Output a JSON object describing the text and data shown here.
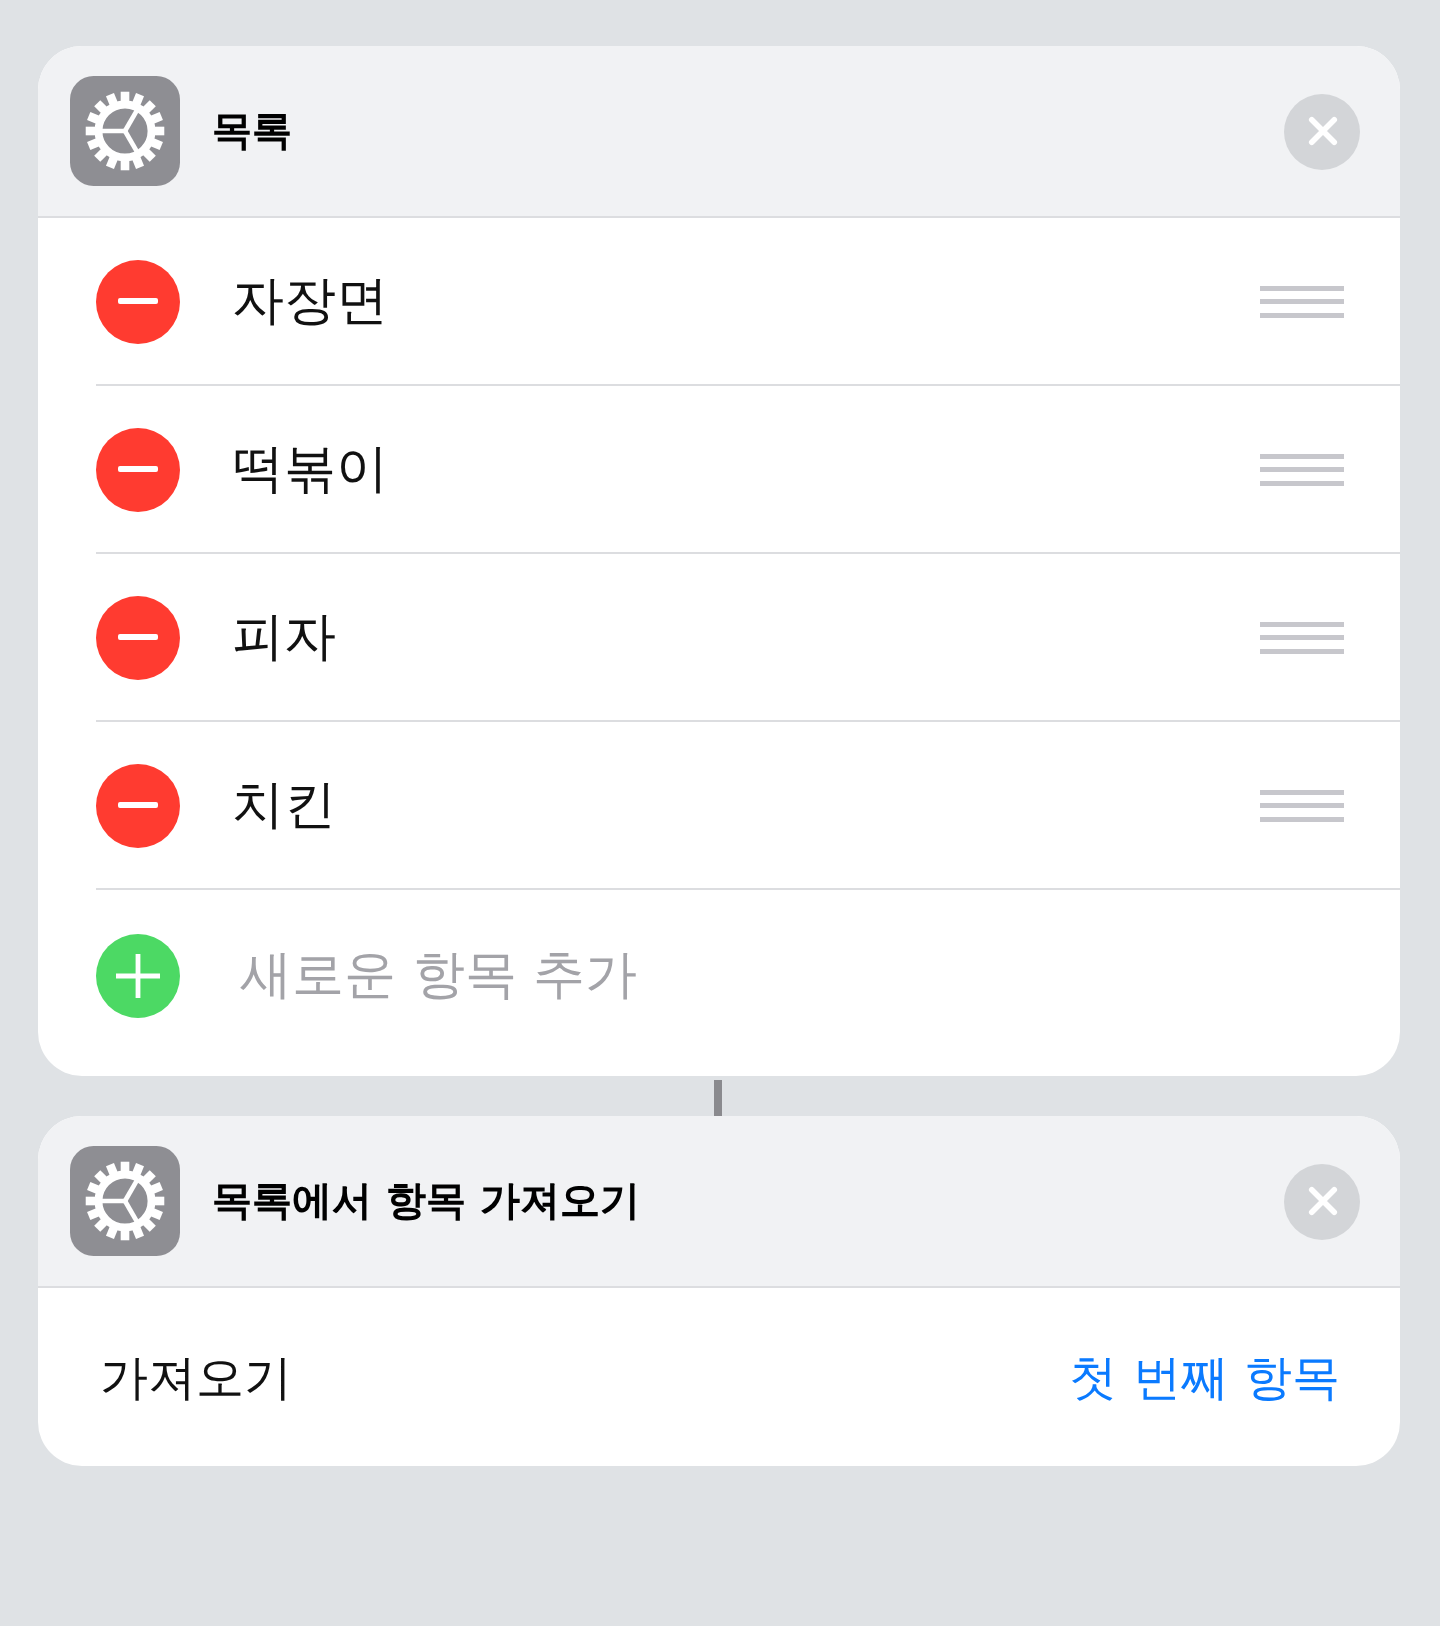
{
  "actions": [
    {
      "kind": "list",
      "title": "목록",
      "items": [
        {
          "text": "자장면"
        },
        {
          "text": "떡볶이"
        },
        {
          "text": "피자"
        },
        {
          "text": "치킨"
        }
      ],
      "add": {
        "placeholder": "새로운 항목 추가"
      }
    },
    {
      "kind": "get_item",
      "title": "목록에서 항목 가져오기",
      "parameter": {
        "label": "가져오기",
        "value": "첫 번째 항목"
      }
    }
  ]
}
